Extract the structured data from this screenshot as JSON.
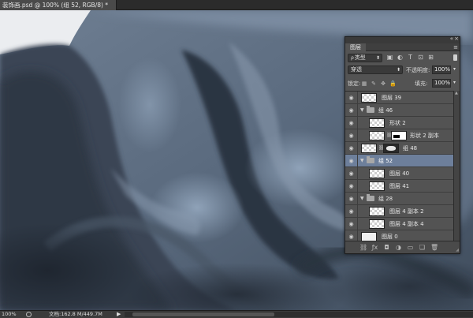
{
  "document": {
    "tab_title": "装饰画.psd @ 100% (组 52, RGB/8) *"
  },
  "status": {
    "zoom": "100%",
    "doc_info": "文档:162.8 M/449.7M",
    "more_arrow": "▶"
  },
  "colors": {
    "selected_layer": "#6d7f9b",
    "panel_bg": "#535353"
  },
  "layers_panel": {
    "tab": "图层",
    "collapse_icon": "«",
    "close_icon": "×",
    "menu_icon": "≡",
    "filter_kind": "类型",
    "filter_kind_icon": "ρ",
    "blend_mode": "穿透",
    "opacity_label": "不透明度:",
    "opacity_value": "100%",
    "lock_label": "锁定:",
    "fill_label": "填充:",
    "fill_value": "100%",
    "layers": [
      {
        "name": "图层 39",
        "type": "layer"
      },
      {
        "name": "组 46",
        "type": "group"
      },
      {
        "name": "形状 2",
        "type": "layer"
      },
      {
        "name": "形状 2 副本",
        "type": "shape"
      },
      {
        "name": "组 48",
        "type": "group-collapsed"
      },
      {
        "name": "组 52",
        "type": "group",
        "selected": true
      },
      {
        "name": "图层 40",
        "type": "layer"
      },
      {
        "name": "图层 41",
        "type": "layer"
      },
      {
        "name": "组 28",
        "type": "group"
      },
      {
        "name": "图层 4 副本 2",
        "type": "layer"
      },
      {
        "name": "图层 4 副本 4",
        "type": "layer"
      },
      {
        "name": "图层 0",
        "type": "layer"
      }
    ],
    "footer_icons": [
      "link-icon",
      "fx-icon",
      "mask-icon",
      "adjustment-icon",
      "new-group-icon",
      "new-layer-icon",
      "trash-icon"
    ]
  }
}
